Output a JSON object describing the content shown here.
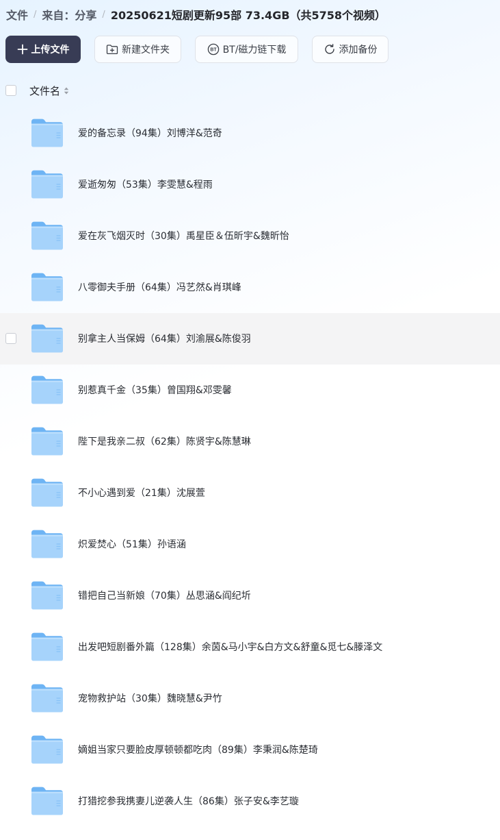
{
  "breadcrumb": {
    "root": "文件",
    "source": "来自：分享",
    "current": "20250621短剧更新95部 73.4GB（共5758个视频）",
    "separator": "/"
  },
  "toolbar": {
    "upload_label": "上传文件",
    "new_folder_label": "新建文件夹",
    "bt_label": "BT/磁力链下载",
    "backup_label": "添加备份"
  },
  "list_header": {
    "name_label": "文件名"
  },
  "files": [
    {
      "name": "爱的备忘录（94集）刘博洋&范奇",
      "type": "folder"
    },
    {
      "name": "爱逝匆匆（53集）李雯慧&程雨",
      "type": "folder"
    },
    {
      "name": "爱在灰飞烟灭时（30集）禹星臣＆伍昕宇&魏昕怡",
      "type": "folder"
    },
    {
      "name": "八零御夫手册（64集）冯艺然&肖琪峰",
      "type": "folder"
    },
    {
      "name": "别拿主人当保姆（64集）刘渝展&陈俊羽",
      "type": "folder",
      "hovered": true
    },
    {
      "name": "别惹真千金（35集）曾国翔&邓雯馨",
      "type": "folder"
    },
    {
      "name": "陛下是我亲二叔（62集）陈贤宇&陈慧琳",
      "type": "folder"
    },
    {
      "name": "不小心遇到爱（21集）沈展萱",
      "type": "folder"
    },
    {
      "name": "炽爱焚心（51集）孙语涵",
      "type": "folder"
    },
    {
      "name": "错把自己当新娘（70集）丛思涵&阎纪圻",
      "type": "folder"
    },
    {
      "name": "出发吧短剧番外篇（128集）余茵&马小宇&白方文&舒童&觅七&滕泽文",
      "type": "folder"
    },
    {
      "name": "宠物救护站（30集）魏晓慧&尹竹",
      "type": "folder"
    },
    {
      "name": "嫡姐当家只要脸皮厚顿顿都吃肉（89集）李秉润&陈楚琦",
      "type": "folder"
    },
    {
      "name": "打猎挖参我携妻儿逆袭人生（86集）张子安&李艺璇",
      "type": "folder"
    }
  ],
  "colors": {
    "primary_button": "#383c55",
    "folder_light": "#a6d3fb",
    "folder_dark": "#6eb4f4",
    "hover_row": "#f4f4f5"
  }
}
